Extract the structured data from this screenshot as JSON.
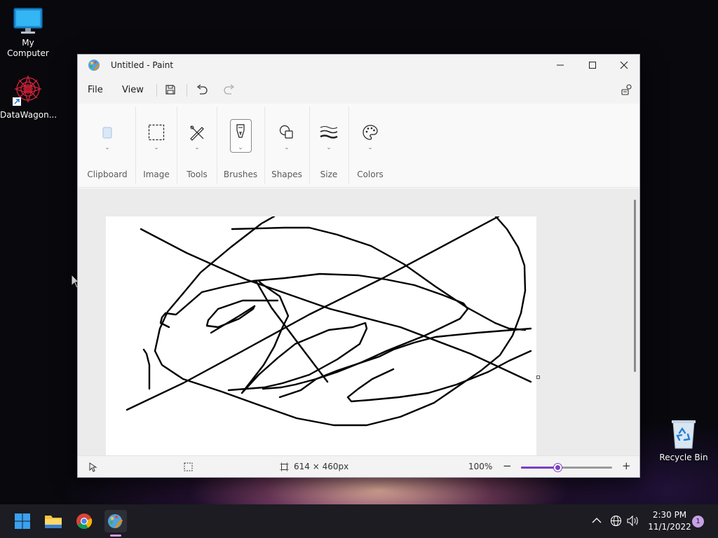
{
  "desktop": {
    "icons": [
      {
        "label": "My Computer"
      },
      {
        "label": "DataWagon..."
      },
      {
        "label": "Recycle Bin"
      }
    ]
  },
  "window": {
    "title": "Untitled - Paint",
    "menu": {
      "file": "File",
      "view": "View"
    },
    "ribbon": {
      "groups": [
        "Clipboard",
        "Image",
        "Tools",
        "Brushes",
        "Shapes",
        "Size",
        "Colors"
      ]
    },
    "status": {
      "canvas_size": "614 × 460px",
      "zoom": "100%",
      "zoom_fraction": 0.4
    }
  },
  "taskbar": {
    "time": "2:30 PM",
    "date": "11/1/2022",
    "notifications": "1"
  },
  "colors": {
    "accent": "#7b3fc4",
    "taskbar": "#1c1c22"
  }
}
